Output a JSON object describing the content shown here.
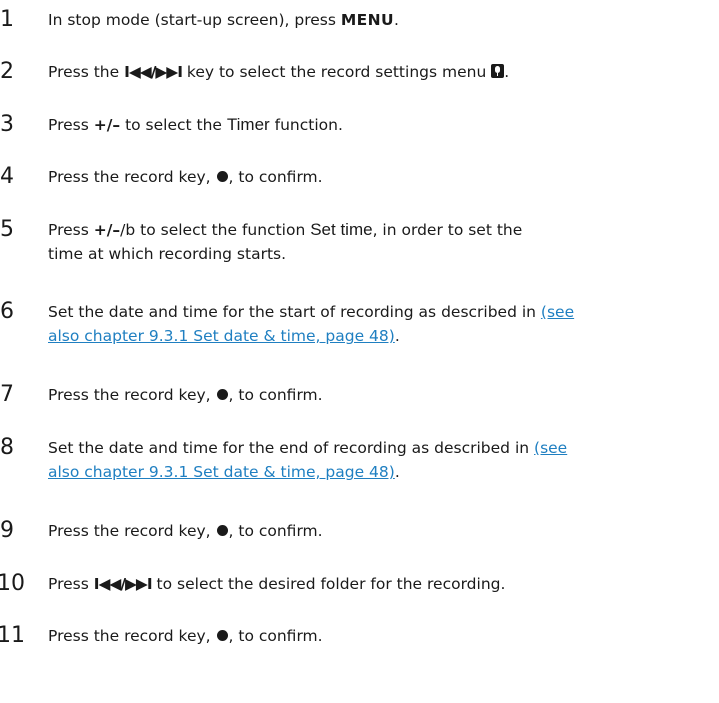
{
  "steps": [
    {
      "number": "1",
      "parts": [
        "In stop mode (start-up screen), press ",
        "MENU",
        "."
      ]
    },
    {
      "number": "2",
      "parts": [
        "Press the ",
        "I◀◀/▶▶I",
        " key to select the record settings menu ",
        "."
      ],
      "icon": "microphone-icon"
    },
    {
      "number": "3",
      "parts": [
        "Press ",
        "+/–",
        " to select the ",
        "Timer",
        " function."
      ]
    },
    {
      "number": "4",
      "parts": [
        "Press the record key, ",
        ", to confirm."
      ],
      "icon": "record-dot-icon"
    },
    {
      "number": "5",
      "parts": [
        "Press ",
        "+/–",
        "/b to select the function ",
        "Set time",
        ", in order to set the",
        "time at which recording starts."
      ]
    },
    {
      "number": "6",
      "parts": [
        "Set the date and time for the start of recording as described in ",
        "(see",
        "also chapter 9.3.1 Set date & time, page 48)",
        "."
      ]
    },
    {
      "number": "7",
      "parts": [
        "Press the record key, ",
        ", to confirm."
      ],
      "icon": "record-dot-icon"
    },
    {
      "number": "8",
      "parts": [
        "Set the date and time for the end of recording as described in ",
        "(see",
        "also chapter 9.3.1 Set date & time, page 48)",
        "."
      ]
    },
    {
      "number": "9",
      "parts": [
        "Press the record key, ",
        ", to confirm."
      ],
      "icon": "record-dot-icon"
    },
    {
      "number": "10",
      "parts": [
        "Press ",
        "I◀◀/▶▶I",
        " to select the desired folder for the recording."
      ]
    },
    {
      "number": "11",
      "parts": [
        "Press the record key, ",
        ", to confirm."
      ],
      "icon": "record-dot-icon"
    }
  ],
  "colors": {
    "text": "#1a1a1a",
    "link": "#1f7fc1"
  }
}
